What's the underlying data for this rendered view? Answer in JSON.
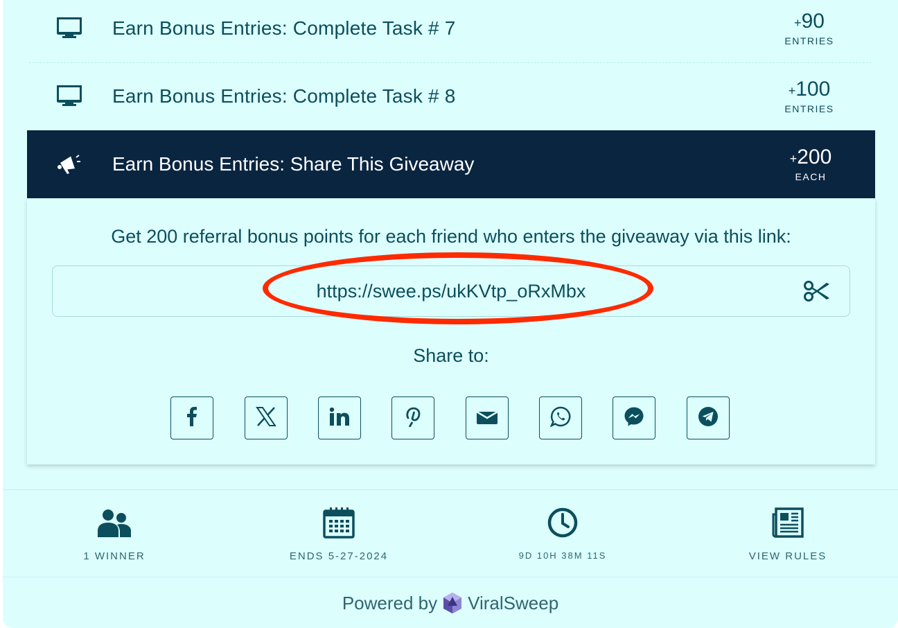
{
  "entries": [
    {
      "label": "Earn Bonus Entries: Complete Task # 7",
      "points": "90",
      "unit": "ENTRIES",
      "icon": "monitor-icon"
    },
    {
      "label": "Earn Bonus Entries: Complete Task # 8",
      "points": "100",
      "unit": "ENTRIES",
      "icon": "monitor-icon"
    }
  ],
  "active": {
    "label": "Earn Bonus Entries: Share This Giveaway",
    "points": "200",
    "unit": "EACH",
    "icon": "megaphone-icon",
    "referral_text": "Get 200 referral bonus points for each friend who enters the giveaway via this link:",
    "link": "https://swee.ps/ukKVtp_oRxMbx",
    "copy_icon": "scissors-icon",
    "share_label": "Share to:",
    "share_buttons": [
      "facebook-icon",
      "x-icon",
      "linkedin-icon",
      "pinterest-icon",
      "email-icon",
      "whatsapp-icon",
      "messenger-icon",
      "telegram-icon"
    ]
  },
  "stats": {
    "winners": "1 WINNER",
    "ends": "ENDS 5-27-2024",
    "countdown": "9D 10H 38M 11S",
    "rules": "VIEW RULES"
  },
  "footer": {
    "powered_by": "Powered by",
    "brand": "ViralSweep"
  },
  "colors": {
    "panel_bg": "#dcfffe",
    "active_header_bg": "#0a2540",
    "text": "#0c4e5c",
    "highlight": "#ff2a00"
  }
}
